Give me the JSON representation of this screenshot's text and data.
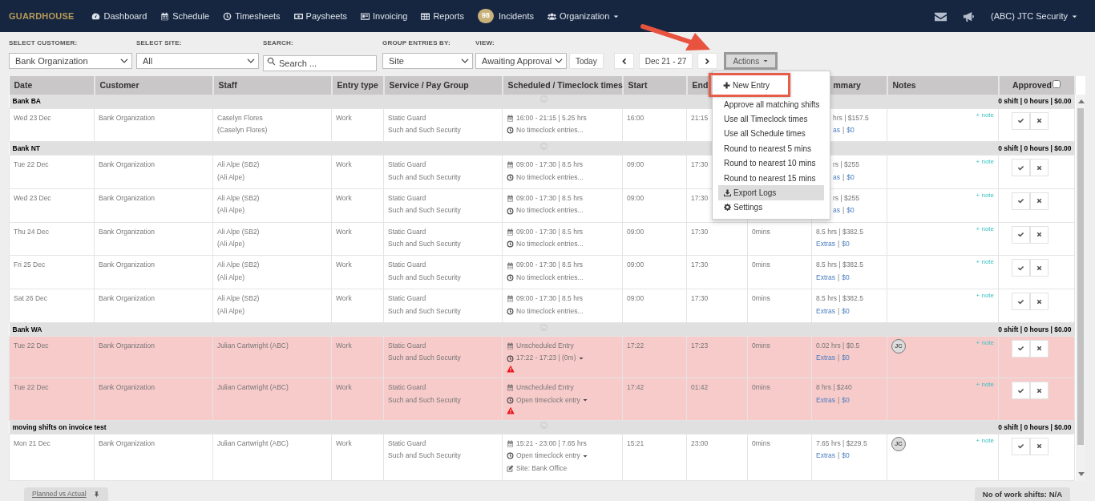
{
  "brand": "GUARDHOUSE",
  "nav": [
    {
      "label": "Dashboard"
    },
    {
      "label": "Schedule"
    },
    {
      "label": "Timesheets"
    },
    {
      "label": "Paysheets"
    },
    {
      "label": "Invoicing"
    },
    {
      "label": "Reports"
    },
    {
      "label": "Incidents",
      "badge": "98"
    },
    {
      "label": "Organization",
      "dropdown": true
    }
  ],
  "user_menu": "(ABC) JTC Security",
  "filters": [
    {
      "label": "SELECT CUSTOMER:",
      "kind": "select",
      "value": "Bank Organization"
    },
    {
      "label": "SELECT SITE:",
      "kind": "select",
      "value": "All"
    },
    {
      "label": "SEARCH:",
      "kind": "search",
      "placeholder": "Search ..."
    },
    {
      "label": "GROUP ENTRIES BY:",
      "kind": "select",
      "value": "Site"
    },
    {
      "label": "VIEW:",
      "kind": "select",
      "value": "Awaiting Approval"
    }
  ],
  "today_button": "Today",
  "date_range": "Dec 21 - 27",
  "actions_button": "Actions",
  "actions_menu": [
    {
      "label": "New Entry",
      "highlighted": true,
      "hovered": false
    },
    {
      "label": "Approve all matching shifts",
      "highlighted": false,
      "hovered": false
    },
    {
      "label": "Use all Timeclock times",
      "highlighted": false,
      "hovered": false
    },
    {
      "label": "Use all Schedule times",
      "highlighted": false,
      "hovered": false
    },
    {
      "label": "Round to nearest 5 mins",
      "highlighted": false,
      "hovered": false
    },
    {
      "label": "Round to nearest 10 mins",
      "highlighted": false,
      "hovered": false
    },
    {
      "label": "Round to nearest 15 mins",
      "highlighted": false,
      "hovered": false
    },
    {
      "label": "Export Logs",
      "highlighted": false,
      "hovered": true
    },
    {
      "label": "Settings",
      "highlighted": false,
      "hovered": false
    }
  ],
  "table": {
    "columns": [
      {
        "label": "Date"
      },
      {
        "label": "Customer"
      },
      {
        "label": "Staff"
      },
      {
        "label": "Entry type"
      },
      {
        "label": "Service / Pay Group"
      },
      {
        "label": "Scheduled / Timeclock times"
      },
      {
        "label": "Start"
      },
      {
        "label": "End"
      },
      {
        "label": "mmary",
        "under_menu": true
      },
      {
        "label": "Notes"
      },
      {
        "label": "Approved",
        "checkbox": true
      }
    ],
    "approve_all_checked": false,
    "groups": [
      {
        "name": "Bank BA",
        "totals": "0 shift | 0 hours | $0.00",
        "rows": [
          {
            "date": "Wed 23 Dec",
            "customer": "Bank Organization",
            "staff": [
              "Caselyn Flores",
              "(Caselyn Flores)"
            ],
            "entry_type": "Work",
            "service": "Static Guard",
            "pay_group": "Such and Such Security",
            "schedule": "16:00 - 21:15 | 5.25 hrs",
            "timeclock": "No timeclock entries...",
            "timeclock_menu": false,
            "alert": false,
            "start": "16:00",
            "end": "21:15",
            "under_menu": true,
            "summary": "hrs | $157.5",
            "extras": "as",
            "divider": "|",
            "extras_amount": "$0",
            "note": "+ note",
            "flagged": false
          }
        ]
      },
      {
        "name": "Bank NT",
        "totals": "0 shift | 0 hours | $0.00",
        "rows": [
          {
            "date": "Tue 22 Dec",
            "customer": "Bank Organization",
            "staff": [
              "Ali Alpe (SB2)",
              "(Ali Alpe)"
            ],
            "entry_type": "Work",
            "service": "Static Guard",
            "pay_group": "Such and Such Security",
            "schedule": "09:00 - 17:30 | 8.5 hrs",
            "timeclock": "No timeclock entries...",
            "timeclock_menu": false,
            "alert": false,
            "start": "09:00",
            "end": "17:30",
            "under_menu": true,
            "summary": "rs | $255",
            "extras": "as",
            "divider": "|",
            "extras_amount": "$0",
            "note": "+ note",
            "flagged": false
          },
          {
            "date": "Wed 23 Dec",
            "customer": "Bank Organization",
            "staff": [
              "Ali Alpe (SB2)",
              "(Ali Alpe)"
            ],
            "entry_type": "Work",
            "service": "Static Guard",
            "pay_group": "Such and Such Security",
            "schedule": "09:00 - 17:30 | 8.5 hrs",
            "timeclock": "No timeclock entries...",
            "timeclock_menu": false,
            "alert": false,
            "start": "09:00",
            "end": "17:30",
            "under_menu": true,
            "summary": "rs | $255",
            "extras": "as",
            "divider": "|",
            "extras_amount": "$0",
            "note": "+ note",
            "flagged": false
          },
          {
            "date": "Thu 24 Dec",
            "customer": "Bank Organization",
            "staff": [
              "Ali Alpe (SB2)",
              "(Ali Alpe)"
            ],
            "entry_type": "Work",
            "service": "Static Guard",
            "pay_group": "Such and Such Security",
            "schedule": "09:00 - 17:30 | 8.5 hrs",
            "timeclock": "No timeclock entries...",
            "timeclock_menu": false,
            "alert": false,
            "start": "09:00",
            "end": "17:30",
            "break": "0mins",
            "under_menu": false,
            "summary": "8.5 hrs | $382.5",
            "extras": "Extras",
            "divider": "|",
            "extras_amount": "$0",
            "note": "+ note",
            "flagged": false
          },
          {
            "date": "Fri 25 Dec",
            "customer": "Bank Organization",
            "staff": [
              "Ali Alpe (SB2)",
              "(Ali Alpe)"
            ],
            "entry_type": "Work",
            "service": "Static Guard",
            "pay_group": "Such and Such Security",
            "schedule": "09:00 - 17:30 | 8.5 hrs",
            "timeclock": "No timeclock entries...",
            "timeclock_menu": false,
            "alert": false,
            "start": "09:00",
            "end": "17:30",
            "break": "0mins",
            "under_menu": false,
            "summary": "8.5 hrs | $382.5",
            "extras": "Extras",
            "divider": "|",
            "extras_amount": "$0",
            "note": "+ note",
            "flagged": false
          },
          {
            "date": "Sat 26 Dec",
            "customer": "Bank Organization",
            "staff": [
              "Ali Alpe (SB2)",
              "(Ali Alpe)"
            ],
            "entry_type": "Work",
            "service": "Static Guard",
            "pay_group": "Such and Such Security",
            "schedule": "09:00 - 17:30 | 8.5 hrs",
            "timeclock": "No timeclock entries...",
            "timeclock_menu": false,
            "alert": false,
            "start": "09:00",
            "end": "17:30",
            "break": "0mins",
            "under_menu": false,
            "summary": "8.5 hrs | $382.5",
            "extras": "Extras",
            "divider": "|",
            "extras_amount": "$0",
            "note": "+ note",
            "flagged": false
          }
        ]
      },
      {
        "name": "Bank WA",
        "totals": "0 shift | 0 hours | $0.00",
        "rows": [
          {
            "date": "Tue 22 Dec",
            "customer": "Bank Organization",
            "staff": [
              "Julian Cartwright (ABC)"
            ],
            "entry_type": "Work",
            "service": "Static Guard",
            "pay_group": "Such and Such Security",
            "schedule": "Unscheduled Entry",
            "timeclock": "17:22 - 17:23 | (0m)",
            "timeclock_menu": true,
            "alert": true,
            "start": "17:22",
            "end": "17:23",
            "break": "0mins",
            "under_menu": false,
            "summary": "0.02 hrs | $0.5",
            "extras": "Extras",
            "divider": "|",
            "extras_amount": "$0",
            "avatar": "JC",
            "note": "+ note",
            "flagged": true
          },
          {
            "date": "Tue 22 Dec",
            "customer": "Bank Organization",
            "staff": [
              "Julian Cartwright (ABC)"
            ],
            "entry_type": "Work",
            "service": "Static Guard",
            "pay_group": "Such and Such Security",
            "schedule": "Unscheduled Entry",
            "timeclock": "Open timeclock entry",
            "timeclock_menu": true,
            "alert": true,
            "start": "17:42",
            "end": "01:42",
            "break": "0mins",
            "under_menu": false,
            "summary": "8 hrs | $240",
            "extras": "Extras",
            "divider": "|",
            "extras_amount": "$0",
            "note": "+ note",
            "flagged": true
          }
        ]
      },
      {
        "name": "moving shifts on invoice test",
        "totals": "0 shift | 0 hours | $0.00",
        "rows": [
          {
            "date": "Mon 21 Dec",
            "customer": "Bank Organization",
            "staff": [
              "Julian Cartwright (ABC)"
            ],
            "entry_type": "Work",
            "service": "Static Guard",
            "pay_group": "Such and Such Security",
            "schedule": "15:21 - 23:00 | 7.65 hrs",
            "timeclock": "Open timeclock entry",
            "timeclock_menu": true,
            "alert": false,
            "site_note": "Site: Bank Office",
            "start": "15:21",
            "end": "23:00",
            "break": "0mins",
            "under_menu": false,
            "summary": "7.65 hrs | $229.5",
            "extras": "Extras",
            "divider": "|",
            "extras_amount": "$0",
            "avatar": "JC",
            "note": "+ note",
            "flagged": false
          }
        ]
      }
    ]
  },
  "footer": {
    "tab": "Planned vs Actual",
    "count": "No of work shifts: N/A"
  }
}
